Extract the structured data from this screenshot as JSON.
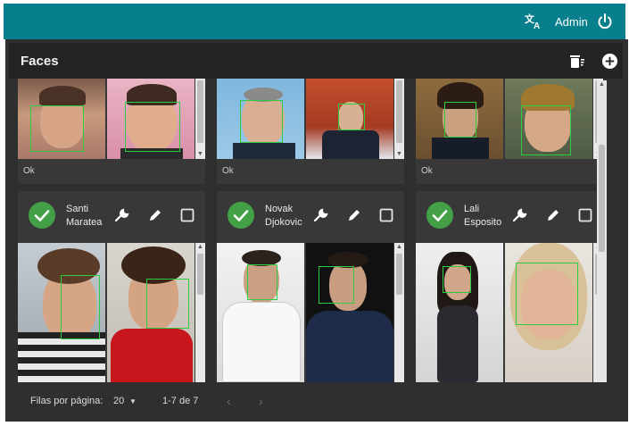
{
  "topbar": {
    "user_label": "Admin",
    "translate_icon": "translate-icon",
    "power_icon": "power-icon",
    "bg_color": "#087f8c"
  },
  "panel": {
    "title": "Faces",
    "filter_icon": "delete-filter-icon",
    "add_icon": "add-circle-icon"
  },
  "top_cards": [
    {
      "status": "Ok"
    },
    {
      "status": "Ok"
    },
    {
      "status": "Ok"
    }
  ],
  "people": [
    {
      "name_line1": "Santi",
      "name_line2": "Maratea",
      "status_color": "#43a047"
    },
    {
      "name_line1": "Novak",
      "name_line2": "Djokovic",
      "status_color": "#43a047"
    },
    {
      "name_line1": "Lali",
      "name_line2": "Esposito",
      "status_color": "#43a047"
    }
  ],
  "pagination": {
    "rows_per_page_label": "Filas por página:",
    "rows_per_page_value": "20",
    "range_label": "1-7 de 7",
    "prev_icon": "chevron-left-icon",
    "next_icon": "chevron-right-icon"
  }
}
